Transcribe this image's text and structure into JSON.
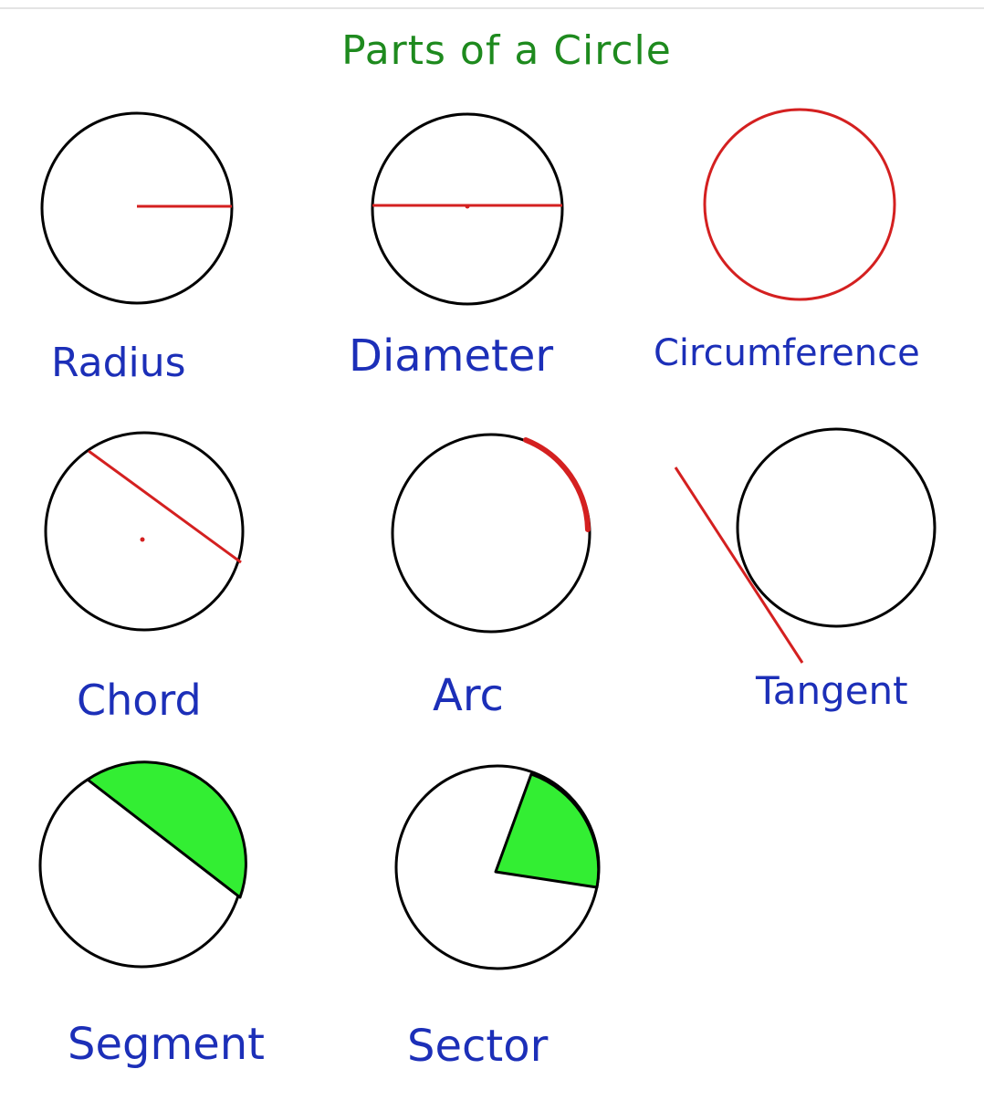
{
  "title": "Parts of a Circle",
  "colors": {
    "title": "#1e8a1e",
    "label": "#1c2fb8",
    "outline": "#000000",
    "highlight": "#d42020",
    "fill": "#33ee33"
  },
  "items": [
    {
      "label": "Radius"
    },
    {
      "label": "Diameter"
    },
    {
      "label": "Circumference"
    },
    {
      "label": "Chord"
    },
    {
      "label": "Arc"
    },
    {
      "label": "Tangent"
    },
    {
      "label": "Segment"
    },
    {
      "label": "Sector"
    }
  ]
}
